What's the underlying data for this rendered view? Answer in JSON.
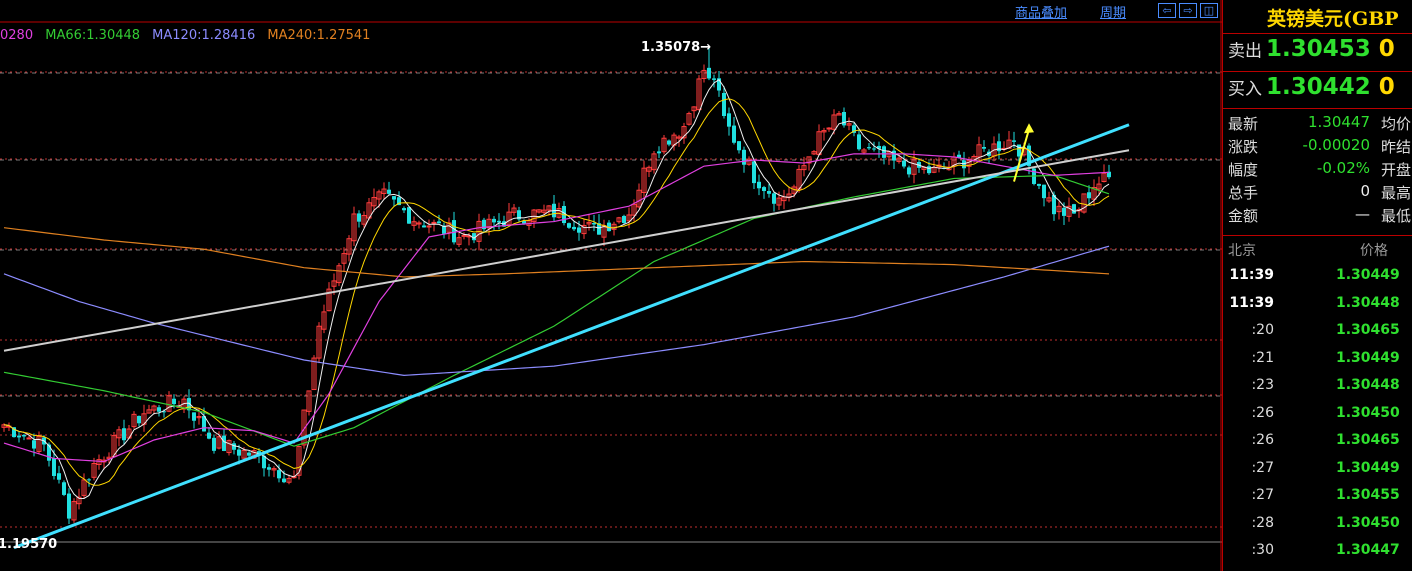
{
  "header": {
    "links": [
      "商品叠加",
      "周期"
    ],
    "window_buttons": [
      "⇦",
      "⇨",
      "◫"
    ]
  },
  "ma_legend": [
    {
      "label": "0280",
      "color": "#e040e0"
    },
    {
      "label": "MA66:1.30448",
      "color": "#33cc33"
    },
    {
      "label": "MA120:1.28416",
      "color": "#8c8cff"
    },
    {
      "label": "MA240:1.27541",
      "color": "#e08020"
    }
  ],
  "chart_data": {
    "type": "candlestick",
    "ylim": [
      1.184,
      1.366
    ],
    "grid": "dashed horizontal",
    "annotations": [
      {
        "text": "1.35078→",
        "value": 1.35078,
        "index": 141
      },
      {
        "text": "1.19570",
        "value": 1.1957,
        "index": 13
      }
    ],
    "candles_seed": 7,
    "price_path": [
      [
        0,
        1.228
      ],
      [
        8,
        1.221
      ],
      [
        13,
        1.2
      ],
      [
        18,
        1.215
      ],
      [
        28,
        1.232
      ],
      [
        36,
        1.236
      ],
      [
        42,
        1.222
      ],
      [
        50,
        1.218
      ],
      [
        58,
        1.21
      ],
      [
        63,
        1.26
      ],
      [
        70,
        1.295
      ],
      [
        76,
        1.302
      ],
      [
        82,
        1.295
      ],
      [
        92,
        1.289
      ],
      [
        102,
        1.296
      ],
      [
        110,
        1.297
      ],
      [
        118,
        1.291
      ],
      [
        125,
        1.297
      ],
      [
        130,
        1.318
      ],
      [
        136,
        1.325
      ],
      [
        141,
        1.348
      ],
      [
        144,
        1.327
      ],
      [
        150,
        1.309
      ],
      [
        155,
        1.301
      ],
      [
        158,
        1.305
      ],
      [
        162,
        1.319
      ],
      [
        167,
        1.328
      ],
      [
        171,
        1.318
      ],
      [
        178,
        1.313
      ],
      [
        186,
        1.31
      ],
      [
        195,
        1.316
      ],
      [
        202,
        1.321
      ],
      [
        206,
        1.309
      ],
      [
        210,
        1.298
      ],
      [
        214,
        1.296
      ],
      [
        218,
        1.306
      ],
      [
        221,
        1.308
      ]
    ],
    "ma_lines": [
      {
        "name": "MA66",
        "color": "#33cc33",
        "points": [
          [
            0,
            1.245
          ],
          [
            20,
            1.239
          ],
          [
            40,
            1.232
          ],
          [
            58,
            1.221
          ],
          [
            70,
            1.227
          ],
          [
            90,
            1.244
          ],
          [
            110,
            1.26
          ],
          [
            130,
            1.281
          ],
          [
            150,
            1.295
          ],
          [
            170,
            1.302
          ],
          [
            190,
            1.308
          ],
          [
            210,
            1.309
          ],
          [
            221,
            1.303
          ]
        ]
      },
      {
        "name": "MA120",
        "color": "#8c8cff",
        "points": [
          [
            0,
            1.277
          ],
          [
            15,
            1.268
          ],
          [
            30,
            1.261
          ],
          [
            45,
            1.255
          ],
          [
            60,
            1.249
          ],
          [
            80,
            1.244
          ],
          [
            110,
            1.247
          ],
          [
            140,
            1.254
          ],
          [
            170,
            1.263
          ],
          [
            200,
            1.276
          ],
          [
            221,
            1.286
          ]
        ]
      },
      {
        "name": "MA240",
        "color": "#e08020",
        "points": [
          [
            0,
            1.292
          ],
          [
            20,
            1.288
          ],
          [
            40,
            1.285
          ],
          [
            60,
            1.279
          ],
          [
            80,
            1.276
          ],
          [
            100,
            1.277
          ],
          [
            130,
            1.279
          ],
          [
            160,
            1.281
          ],
          [
            190,
            1.28
          ],
          [
            221,
            1.277
          ]
        ]
      },
      {
        "name": "MA20",
        "color": "#e040e0",
        "points": [
          [
            0,
            1.222
          ],
          [
            10,
            1.217
          ],
          [
            20,
            1.216
          ],
          [
            30,
            1.223
          ],
          [
            40,
            1.227
          ],
          [
            50,
            1.226
          ],
          [
            58,
            1.222
          ],
          [
            65,
            1.238
          ],
          [
            75,
            1.268
          ],
          [
            85,
            1.289
          ],
          [
            95,
            1.292
          ],
          [
            110,
            1.294
          ],
          [
            125,
            1.299
          ],
          [
            140,
            1.312
          ],
          [
            150,
            1.314
          ],
          [
            160,
            1.313
          ],
          [
            170,
            1.316
          ],
          [
            180,
            1.316
          ],
          [
            190,
            1.315
          ],
          [
            200,
            1.312
          ],
          [
            210,
            1.309
          ],
          [
            221,
            1.31
          ]
        ]
      }
    ],
    "trend_lines": [
      {
        "color": "#40e0ff",
        "width": 3,
        "from": [
          2,
          1.188
        ],
        "to": [
          221,
          1.323
        ]
      },
      {
        "color": "#cfcfcf",
        "width": 2,
        "from": [
          0,
          1.252
        ],
        "to": [
          221,
          1.316
        ]
      }
    ],
    "arrow": {
      "color": "#ffff30",
      "from": [
        202,
        1.307
      ],
      "to": [
        205,
        1.324
      ]
    }
  },
  "panel": {
    "title": "英镑美元(GBP",
    "sell_label": "卖出",
    "sell_value": "1.30453",
    "sell_vol": "0",
    "buy_label": "买入",
    "buy_value": "1.30442",
    "buy_vol": "0",
    "info": [
      {
        "label": "最新",
        "value": "1.30447",
        "label2": "均价",
        "color": "green"
      },
      {
        "label": "涨跌",
        "value": "-0.00020",
        "label2": "昨结",
        "color": "green"
      },
      {
        "label": "幅度",
        "value": "-0.02%",
        "label2": "开盘",
        "color": "green"
      },
      {
        "label": "总手",
        "value": "0",
        "label2": "最高",
        "color": "white"
      },
      {
        "label": "金额",
        "value": "—",
        "label2": "最低",
        "color": "white"
      }
    ],
    "tick_header": {
      "left": "北京",
      "right": "价格"
    },
    "ticks": [
      {
        "time": "11:39",
        "price": "1.30449",
        "bold": true
      },
      {
        "time": "11:39",
        "price": "1.30448",
        "bold": true
      },
      {
        "time": ":20",
        "price": "1.30465",
        "bold": false
      },
      {
        "time": ":21",
        "price": "1.30449",
        "bold": false
      },
      {
        "time": ":23",
        "price": "1.30448",
        "bold": false
      },
      {
        "time": ":26",
        "price": "1.30450",
        "bold": false
      },
      {
        "time": ":26",
        "price": "1.30465",
        "bold": false
      },
      {
        "time": ":27",
        "price": "1.30449",
        "bold": false
      },
      {
        "time": ":27",
        "price": "1.30455",
        "bold": false
      },
      {
        "time": ":28",
        "price": "1.30450",
        "bold": false
      },
      {
        "time": ":30",
        "price": "1.30447",
        "bold": false
      }
    ]
  }
}
